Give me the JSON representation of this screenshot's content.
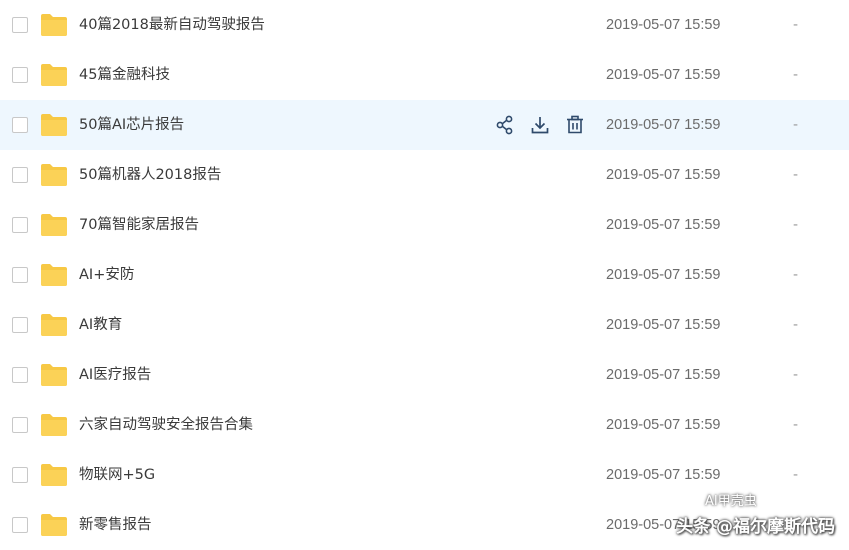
{
  "files": [
    {
      "name": "40篇2018最新自动驾驶报告",
      "modified": "2019-05-07 15:59",
      "size": "-"
    },
    {
      "name": "45篇金融科技",
      "modified": "2019-05-07 15:59",
      "size": "-"
    },
    {
      "name": "50篇AI芯片报告",
      "modified": "2019-05-07 15:59",
      "size": "-",
      "hovered": true
    },
    {
      "name": "50篇机器人2018报告",
      "modified": "2019-05-07 15:59",
      "size": "-"
    },
    {
      "name": "70篇智能家居报告",
      "modified": "2019-05-07 15:59",
      "size": "-"
    },
    {
      "name": "AI+安防",
      "modified": "2019-05-07 15:59",
      "size": "-"
    },
    {
      "name": "AI教育",
      "modified": "2019-05-07 15:59",
      "size": "-"
    },
    {
      "name": "AI医疗报告",
      "modified": "2019-05-07 15:59",
      "size": "-"
    },
    {
      "name": "六家自动驾驶安全报告合集",
      "modified": "2019-05-07 15:59",
      "size": "-"
    },
    {
      "name": "物联网+5G",
      "modified": "2019-05-07 15:59",
      "size": "-"
    },
    {
      "name": "新零售报告",
      "modified": "2019-05-07 15:59",
      "size": "-"
    }
  ],
  "row_actions": [
    {
      "icon": "share-icon"
    },
    {
      "icon": "download-icon"
    },
    {
      "icon": "delete-icon"
    }
  ],
  "watermark": {
    "main": "头条 @福尔摩斯代码",
    "secondary": "AI甲壳虫"
  },
  "colors": {
    "folder": "#f7c844",
    "hover_row": "#eef7fe",
    "action_icon": "#2f4a6b"
  }
}
